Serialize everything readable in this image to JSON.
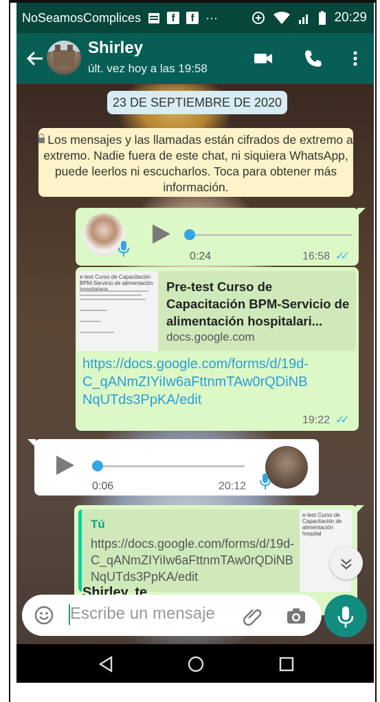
{
  "status_bar": {
    "carrier": "NoSeamosComplices",
    "notification_icons": [
      "calendar-icon",
      "facebook-icon",
      "facebook-icon",
      "more-icon"
    ],
    "time": "20:29"
  },
  "header": {
    "contact_name": "Shirley",
    "last_seen": "últ. vez hoy a las 19:58",
    "color": "#075e54"
  },
  "chat": {
    "date_chip": "23 DE SEPTIEMBRE DE 2020",
    "encryption_notice": "Los mensajes y las llamadas están cifrados de extremo a extremo. Nadie fuera de este chat, ni siquiera WhatsApp, puede leerlos ni escucharlos. Toca para obtener más información.",
    "messages": [
      {
        "type": "voice",
        "direction": "outgoing",
        "duration": "0:24",
        "time": "16:58",
        "progress": 0
      },
      {
        "type": "link",
        "direction": "outgoing",
        "preview_thumb_text": "e-test Curso de Capacitación BPM-Servicio de alimentación hospitalaria.",
        "preview_title": "Pre-test Curso de Capacitación BPM-Servicio de alimentación hospitalari...",
        "preview_domain": "docs.google.com",
        "url": "https://docs.google.com/forms/d/19d-C_qANmZIYiIw6aFttnmTAw0rQDiNBNqUTds3PpKA/edit",
        "time": "19:22"
      },
      {
        "type": "voice",
        "direction": "incoming",
        "duration": "0:06",
        "time": "20:12",
        "progress": 0
      },
      {
        "type": "quoted",
        "direction": "outgoing",
        "quote_author": "Tú",
        "quote_text": "https://docs.google.com/forms/d/19d-C_qANmZIYiIw6aFttnmTAw0rQDiNBNqUTds3PpKA/edit",
        "quote_thumb_text": "e-test Curso de Capacitación de alimentación hospital",
        "partial_text": "Shirley, te..."
      }
    ]
  },
  "composer": {
    "placeholder": "Escribe un mensaje"
  },
  "colors": {
    "outgoing_bubble": "#dcf8c6",
    "incoming_bubble": "#ffffff",
    "read_ticks": "#34b7f1",
    "link": "#2a9ed8",
    "fab": "#128c7e"
  }
}
